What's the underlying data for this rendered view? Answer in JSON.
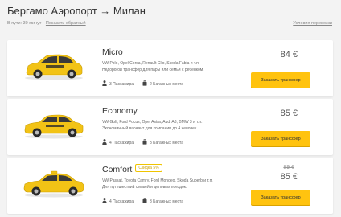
{
  "header": {
    "title": "Бергамо Аэропорт → Милан",
    "trip_info": "В пути: 30 минут",
    "reverse_link": "Показать обратный",
    "terms_link": "Условия перевозки"
  },
  "offers": [
    {
      "class_name": "Micro",
      "badge": "",
      "models": "VW Polo, Opel Corsa, Renault Clio, Skoda Fabia и т.п.",
      "description": "Недорогой трансфер для пары или семьи с ребенком.",
      "passengers": "3 Пассажира",
      "luggage": "2 Багажных места",
      "price": "84 €",
      "old_price": "",
      "button": "Заказать трансфер",
      "car_color": "#f2c316"
    },
    {
      "class_name": "Economy",
      "badge": "",
      "models": "VW Golf, Ford Focus, Opel Astra, Audi A3, BMW 3 и т.п.",
      "description": "Экономичный вариант для компании до 4 человек.",
      "passengers": "4 Пассажира",
      "luggage": "3 Багажных места",
      "price": "85 €",
      "old_price": "",
      "button": "Заказать трансфер",
      "car_color": "#f2c316"
    },
    {
      "class_name": "Comfort",
      "badge": "Скидка 5%",
      "models": "VW Passat, Toyota Camry, Ford Mondeo, Skoda Superb и т.п.",
      "description": "Для путешествий семьей и деловых поездок.",
      "passengers": "4 Пассажира",
      "luggage": "3 Багажных места",
      "price": "85 €",
      "old_price": "89 €",
      "button": "Заказать трансфер",
      "car_color": "#f2c316"
    }
  ],
  "colors": {
    "accent": "#ffc30f",
    "background": "#f3f3f3"
  }
}
